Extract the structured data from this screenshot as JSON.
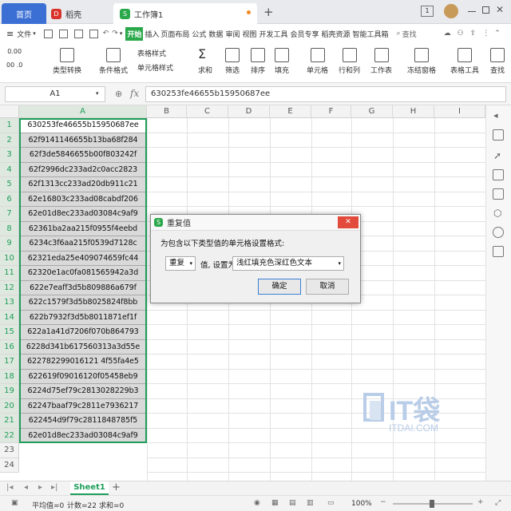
{
  "tabs": {
    "home": "首页",
    "daoke": "稻壳",
    "workbook": "工作簿1"
  },
  "menu": {
    "file": "文件",
    "items": [
      "开始",
      "插入",
      "页面布局",
      "公式",
      "数据",
      "审阅",
      "视图",
      "开发工具",
      "会员专享",
      "稻壳资源",
      "智能工具箱"
    ],
    "search": "查找"
  },
  "ribbon": {
    "type_convert": "类型转换",
    "cond_format": "条件格式",
    "table_style": "表格样式",
    "cell_style": "单元格样式",
    "sum": "求和",
    "filter": "筛选",
    "sort": "排序",
    "fill": "填充",
    "cell": "单元格",
    "rowcol": "行和列",
    "sheet": "工作表",
    "freeze": "冻结窗格",
    "table_tools": "表格工具",
    "find": "查找",
    "num1": "0.00",
    "num2": "00 .0"
  },
  "formula_bar": {
    "cell_ref": "A1",
    "fx": "fx",
    "value": "630253fe46655b15950687ee"
  },
  "columns": [
    "A",
    "B",
    "C",
    "D",
    "E",
    "F",
    "G",
    "H",
    "I"
  ],
  "rows": [
    "1",
    "2",
    "3",
    "4",
    "5",
    "6",
    "7",
    "8",
    "9",
    "10",
    "11",
    "12",
    "13",
    "14",
    "15",
    "16",
    "17",
    "18",
    "19",
    "20",
    "21",
    "22",
    "23",
    "24"
  ],
  "cells_a": [
    "630253fe46655b15950687ee",
    "62f9141146655b13ba68f284",
    "62f3de5846655b00f803242f",
    "62f2996dc233ad2c0acc2823",
    "62f1313cc233ad20db911c21",
    "62e16803c233ad08cabdf206",
    "62e01d8ec233ad03084c9af9",
    "62361ba2aa215f0955f4eebd",
    "6234c3f6aa215f0539d7128c",
    "62321eda25e409074659fc44",
    "62320e1ac0fa081565942a3d",
    "622e7eaff3d5b809886a679f",
    "622c1579f3d5b8025824f8bb",
    "622b7932f3d5b8011871ef1f",
    "622a1a41d7206f070b864793",
    "6228d341b617560313a3d55e",
    "622782299016121 4f55fa4e5",
    "622619f09016120f05458eb9",
    "6224d75ef79c2813028229b3",
    "62247baaf79c2811e7936217",
    "622454d9f79c2811848785f5",
    "62e01d8ec233ad03084c9af9"
  ],
  "dialog": {
    "title": "重复值",
    "prompt": "为包含以下类型值的单元格设置格式:",
    "type_value": "重复",
    "mid_label": "值, 设置为",
    "format_value": "浅红填充色深红色文本",
    "ok": "确定",
    "cancel": "取消"
  },
  "sheet_tab": "Sheet1",
  "status": {
    "avg": "平均值=0",
    "count": "计数=22",
    "sum": "求和=0",
    "zoom": "100%"
  },
  "watermark": {
    "brand": "IT袋",
    "url": "ITDAI.COM"
  },
  "colors": {
    "accent": "#3b6fd4",
    "selection": "#1e9e5a",
    "selected_fill": "#d9d9d9",
    "wps_green": "#2aa84a"
  }
}
